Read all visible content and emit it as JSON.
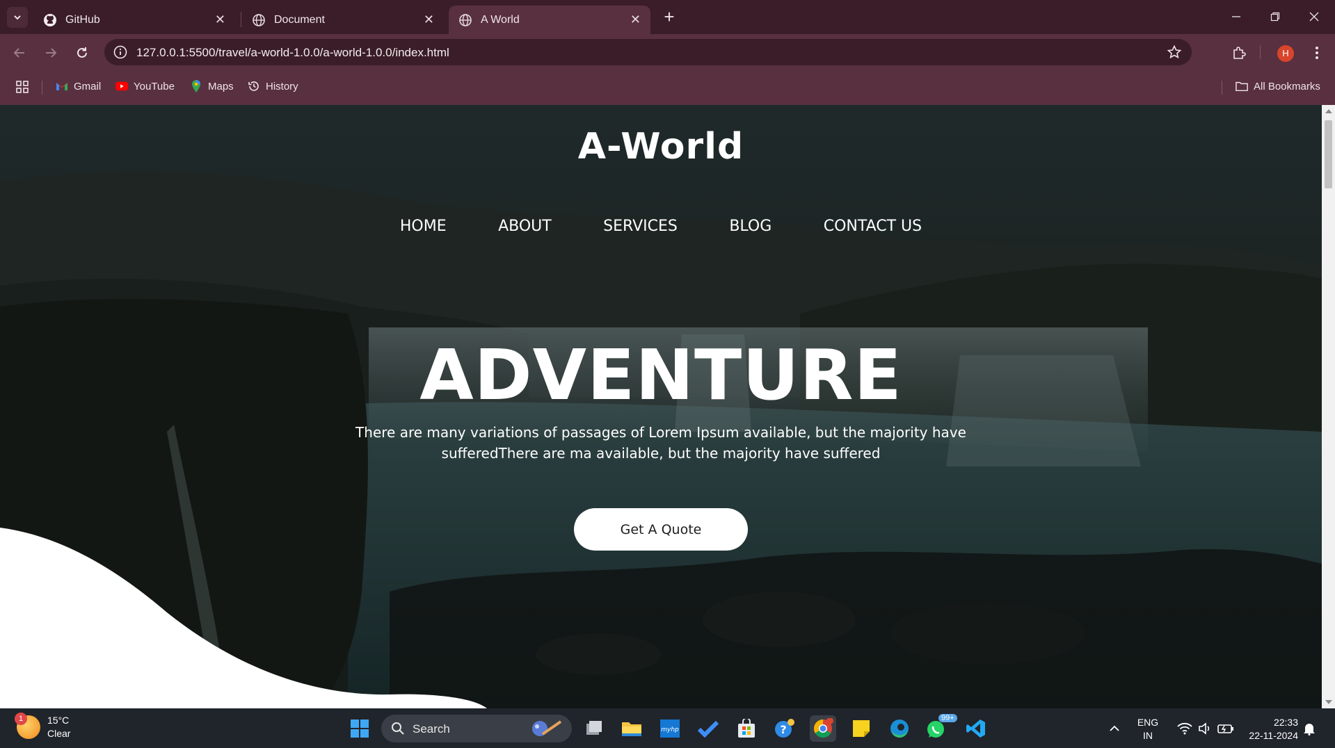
{
  "browser": {
    "tabs": [
      {
        "title": "GitHub",
        "icon": "github-icon"
      },
      {
        "title": "Document",
        "icon": "globe-icon"
      },
      {
        "title": "A World",
        "icon": "globe-icon",
        "active": true
      }
    ],
    "url": "127.0.0.1:5500/travel/a-world-1.0.0/a-world-1.0.0/index.html",
    "profile_initial": "H",
    "bookmarks": [
      {
        "label": "Gmail",
        "icon": "gmail-icon"
      },
      {
        "label": "YouTube",
        "icon": "youtube-icon"
      },
      {
        "label": "Maps",
        "icon": "maps-icon"
      },
      {
        "label": "History",
        "icon": "history-icon"
      }
    ],
    "all_bookmarks_label": "All Bookmarks"
  },
  "page": {
    "logo": "A-World",
    "nav": [
      "HOME",
      "ABOUT",
      "SERVICES",
      "BLOG",
      "CONTACT US"
    ],
    "hero_title": "ADVENTURE",
    "hero_text_line1": "There are many variations of passages of Lorem Ipsum available, but the majority have",
    "hero_text_line2": "sufferedThere are ma available, but the majority have suffered",
    "cta_label": "Get A Quote"
  },
  "taskbar": {
    "weather_badge": "1",
    "weather_temp": "15°C",
    "weather_desc": "Clear",
    "search_label": "Search",
    "whatsapp_badge": "99+",
    "lang_line1": "ENG",
    "lang_line2": "IN",
    "time": "22:33",
    "date": "22-11-2024"
  },
  "colors": {
    "tab_bar": "#3a1d28",
    "toolbar": "#59303f",
    "taskbar": "#20242b",
    "cta_background": "#ffffff"
  }
}
